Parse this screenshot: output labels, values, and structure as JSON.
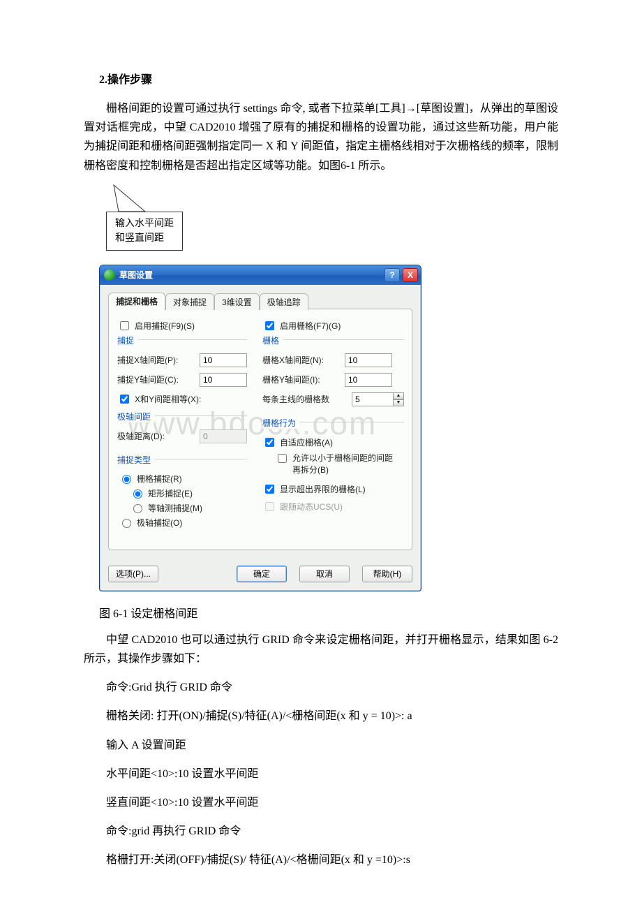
{
  "doc": {
    "heading": "2.操作步骤",
    "para1": "栅格间距的设置可通过执行 settings 命令, 或者下拉菜单[工具]→[草图设置]，从弹出的草图设置对话框完成，中望 CAD2010 增强了原有的捕捉和栅格的设置功能，通过这些新功能，用户能为捕捉间距和栅格间距强制指定同一 X 和 Y 间距值，指定主栅格线相对于次栅格线的频率，限制栅格密度和控制栅格是否超出指定区域等功能。如图6-1 所示。",
    "callout": "输入水平间距\n和竖直间距",
    "caption": "图 6-1 设定栅格间距",
    "para2": "中望 CAD2010 也可以通过执行 GRID 命令来设定栅格间距，并打开栅格显示，结果如图 6-2 所示，其操作步骤如下：",
    "cmd1": "命令:Grid  执行 GRID 命令",
    "cmd2": "栅格关闭: 打开(ON)/捕捉(S)/特征(A)/<栅格间距(x 和 y = 10)>: a",
    "cmd3": "输入 A 设置间距",
    "cmd4": "水平间距<10>:10 设置水平间距",
    "cmd5": "竖直间距<10>:10 设置水平间距",
    "cmd6": "命令:grid  再执行 GRID 命令",
    "cmd7": "格栅打开:关闭(OFF)/捕捉(S)/ 特征(A)/<格栅间距(x 和 y =10)>:s"
  },
  "dialog": {
    "title": "草图设置",
    "help_btn": "?",
    "close_btn": "X",
    "tabs": [
      "捕捉和栅格",
      "对象捕捉",
      "3维设置",
      "极轴追踪"
    ],
    "left": {
      "enable_snap": "启用捕捉(F9)(S)",
      "group_snap": "捕捉",
      "snap_x_label": "捕捉X轴间距(P):",
      "snap_x_value": "10",
      "snap_y_label": "捕捉Y轴间距(C):",
      "snap_y_value": "10",
      "xy_equal": "X和Y间距相等(X):",
      "group_polar_dist": "极轴间距",
      "polar_dist_label": "极轴距离(D):",
      "polar_dist_value": "0",
      "group_snap_type": "捕捉类型",
      "r_grid_snap": "栅格捕捉(R)",
      "r_rect_snap": "矩形捕捉(E)",
      "r_iso_snap": "等轴测捕捉(M)",
      "r_polar_snap": "极轴捕捉(O)"
    },
    "right": {
      "enable_grid": "启用栅格(F7)(G)",
      "group_grid": "栅格",
      "grid_x_label": "栅格X轴间距(N):",
      "grid_x_value": "10",
      "grid_y_label": "栅格Y轴间距(I):",
      "grid_y_value": "10",
      "major_label": "每条主线的栅格数",
      "major_value": "5",
      "group_behavior": "栅格行为",
      "cb_adaptive": "自适应栅格(A)",
      "cb_subdiv": "允许以小于栅格间距的间距再拆分(B)",
      "cb_outlimits": "显示超出界限的栅格(L)",
      "cb_follow_ucs": "跟随动态UCS(U)"
    },
    "footer": {
      "options": "选项(P)...",
      "ok": "确定",
      "cancel": "取消",
      "help": "帮助(H)"
    }
  },
  "watermark": "www.bdocx.com"
}
